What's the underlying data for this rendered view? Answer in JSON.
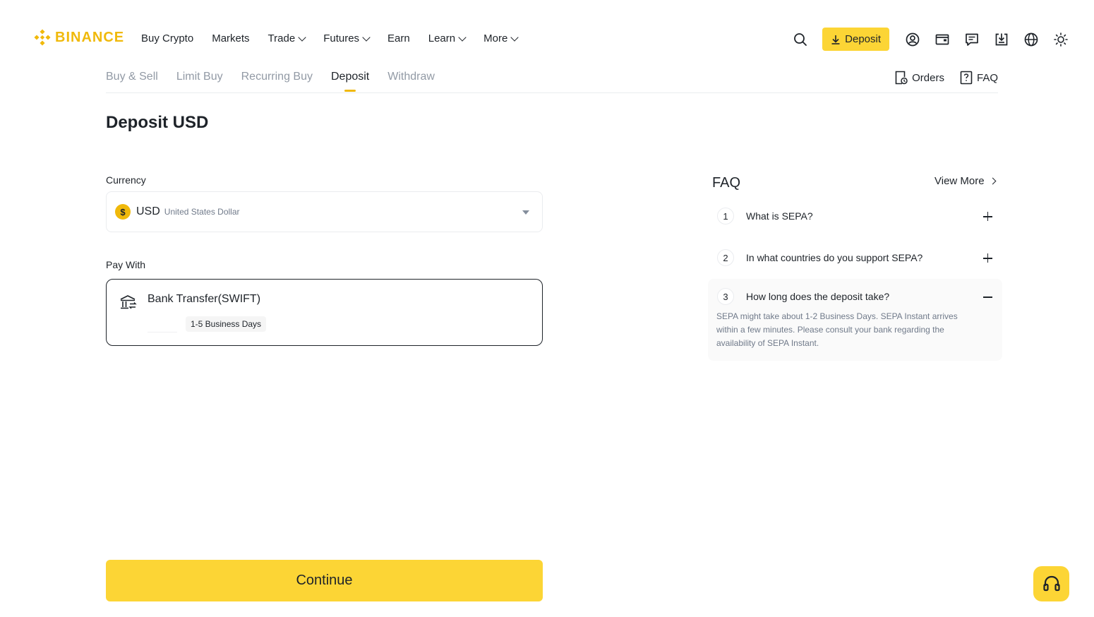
{
  "brand": {
    "name": "BINANCE",
    "color": "#f0b90b"
  },
  "nav": {
    "items": [
      {
        "label": "Buy Crypto",
        "dropdown": false
      },
      {
        "label": "Markets",
        "dropdown": false
      },
      {
        "label": "Trade",
        "dropdown": true
      },
      {
        "label": "Futures",
        "dropdown": true
      },
      {
        "label": "Earn",
        "dropdown": false
      },
      {
        "label": "Learn",
        "dropdown": true
      },
      {
        "label": "More",
        "dropdown": true
      }
    ]
  },
  "header": {
    "deposit_label": "Deposit",
    "icons": [
      "search-icon",
      "download-icon",
      "user-icon",
      "wallet-icon",
      "message-icon",
      "download-app-icon",
      "globe-icon",
      "sun-icon"
    ]
  },
  "subtabs": {
    "items": [
      "Buy & Sell",
      "Limit Buy",
      "Recurring Buy",
      "Deposit",
      "Withdraw"
    ],
    "active": "Deposit",
    "orders_label": "Orders",
    "faq_label": "FAQ"
  },
  "page": {
    "title": "Deposit USD",
    "currency_label": "Currency",
    "currency": {
      "symbol": "$",
      "code": "USD",
      "name": "United States Dollar"
    },
    "pay_with_label": "Pay With",
    "pay_method": {
      "name": "Bank Transfer(SWIFT)",
      "duration": "1-5 Business Days"
    },
    "continue_label": "Continue"
  },
  "faq": {
    "title": "FAQ",
    "view_more": "View More",
    "items": [
      {
        "num": "1",
        "question": "What is SEPA?",
        "open": false,
        "answer": ""
      },
      {
        "num": "2",
        "question": "In what countries do you support SEPA?",
        "open": false,
        "answer": ""
      },
      {
        "num": "3",
        "question": "How long does the deposit take?",
        "open": true,
        "answer": "SEPA might take about 1-2 Business Days. SEPA Instant arrives within a few minutes. Please consult your bank regarding the availability of SEPA Instant."
      }
    ]
  },
  "colors": {
    "accent": "#fcd535",
    "text": "#1e2329",
    "muted": "#929aa5"
  }
}
